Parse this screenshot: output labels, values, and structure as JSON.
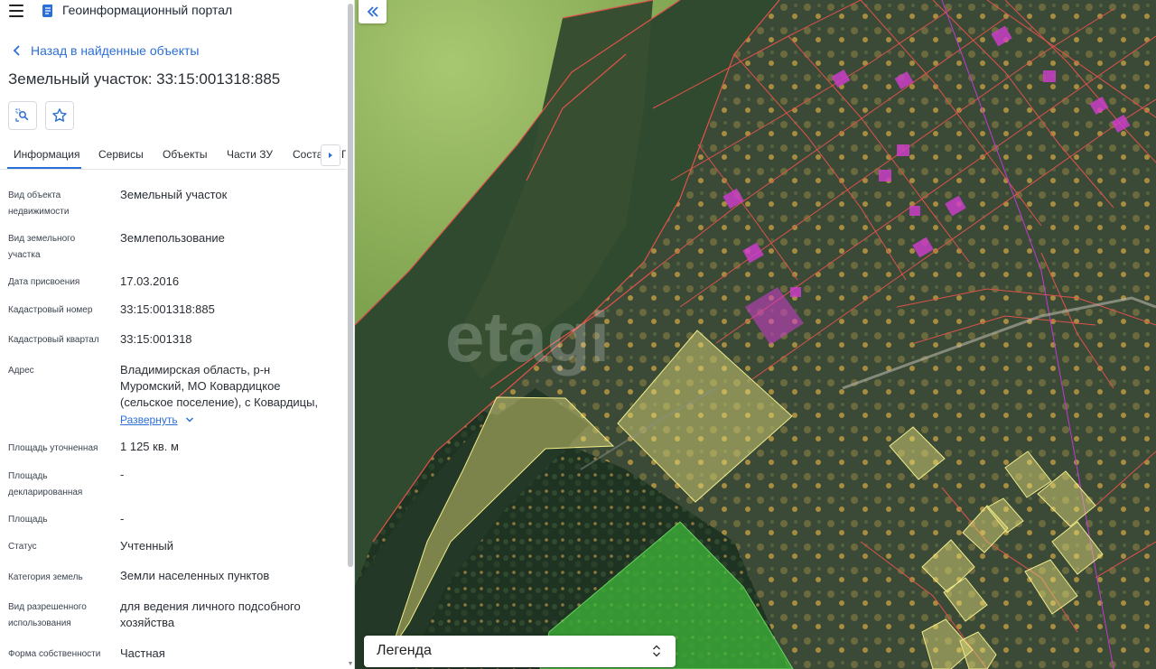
{
  "header": {
    "title": "Геоинформационный портал",
    "menu_icon": "hamburger-icon",
    "logo_icon": "portal-logo-icon"
  },
  "back_link": "Назад в найденные объекты",
  "page_title": "Земельный участок: 33:15:001318:885",
  "actions": [
    {
      "icon": "locate-on-map-icon"
    },
    {
      "icon": "star-icon"
    }
  ],
  "tabs": [
    {
      "label": "Информация",
      "active": true
    },
    {
      "label": "Сервисы",
      "active": false
    },
    {
      "label": "Объекты",
      "active": false
    },
    {
      "label": "Части ЗУ",
      "active": false
    },
    {
      "label": "Соста",
      "active": false
    },
    {
      "label": "Г",
      "active": false
    }
  ],
  "details": [
    {
      "label_lines": [
        "Вид объекта",
        "недвижимости"
      ],
      "value_lines": [
        "Земельный участок"
      ]
    },
    {
      "label_lines": [
        "Вид земельного",
        "участка"
      ],
      "value_lines": [
        "Землепользование"
      ]
    },
    {
      "label_lines": [
        "Дата присвоения"
      ],
      "value_lines": [
        "17.03.2016"
      ]
    },
    {
      "label_lines": [
        "Кадастровый номер"
      ],
      "value_lines": [
        "33:15:001318:885"
      ]
    },
    {
      "label_lines": [
        "Кадастровый квартал"
      ],
      "value_lines": [
        "33:15:001318"
      ]
    },
    {
      "label_lines": [
        "Адрес"
      ],
      "value_lines": [
        "Владимирская область, р-н",
        "Муромский, МО Ковардицкое",
        "(сельское поселение), с Ковардицы,"
      ]
    },
    {
      "label_lines": [
        "Площадь уточненная"
      ],
      "value_lines": [
        "1 125 кв. м"
      ]
    },
    {
      "label_lines": [
        "Площадь",
        "декларированная"
      ],
      "value_lines": [
        "-"
      ]
    },
    {
      "label_lines": [
        "Площадь"
      ],
      "value_lines": [
        "-"
      ]
    },
    {
      "label_lines": [
        "Статус"
      ],
      "value_lines": [
        "Учтенный"
      ]
    },
    {
      "label_lines": [
        "Категория земель"
      ],
      "value_lines": [
        "Земли населенных пунктов"
      ]
    },
    {
      "label_lines": [
        "Вид разрешенного",
        "использования"
      ],
      "value_lines": [
        "для ведения личного подсобного",
        "хозяйства"
      ]
    },
    {
      "label_lines": [
        "Форма собственности"
      ],
      "value_lines": [
        "Частная"
      ]
    }
  ],
  "expand_link": "Развернуть",
  "map": {
    "collapse_icon": "double-chevron-left-icon",
    "legend_label": "Легенда",
    "legend_icon": "up-down-arrows-icon",
    "watermark": "etagi",
    "colors": {
      "field": "#8db35a",
      "water": "#2d4a2c",
      "forest": "#1d3320",
      "parcel_outline": "#e0524a",
      "parcel_yellow": "#e8e37a",
      "parcel_green": "#3fb83a",
      "building_magenta": "#d23ccf"
    }
  },
  "colors": {
    "link": "#2b6fd6",
    "tab_underline": "#2b6fd6"
  }
}
